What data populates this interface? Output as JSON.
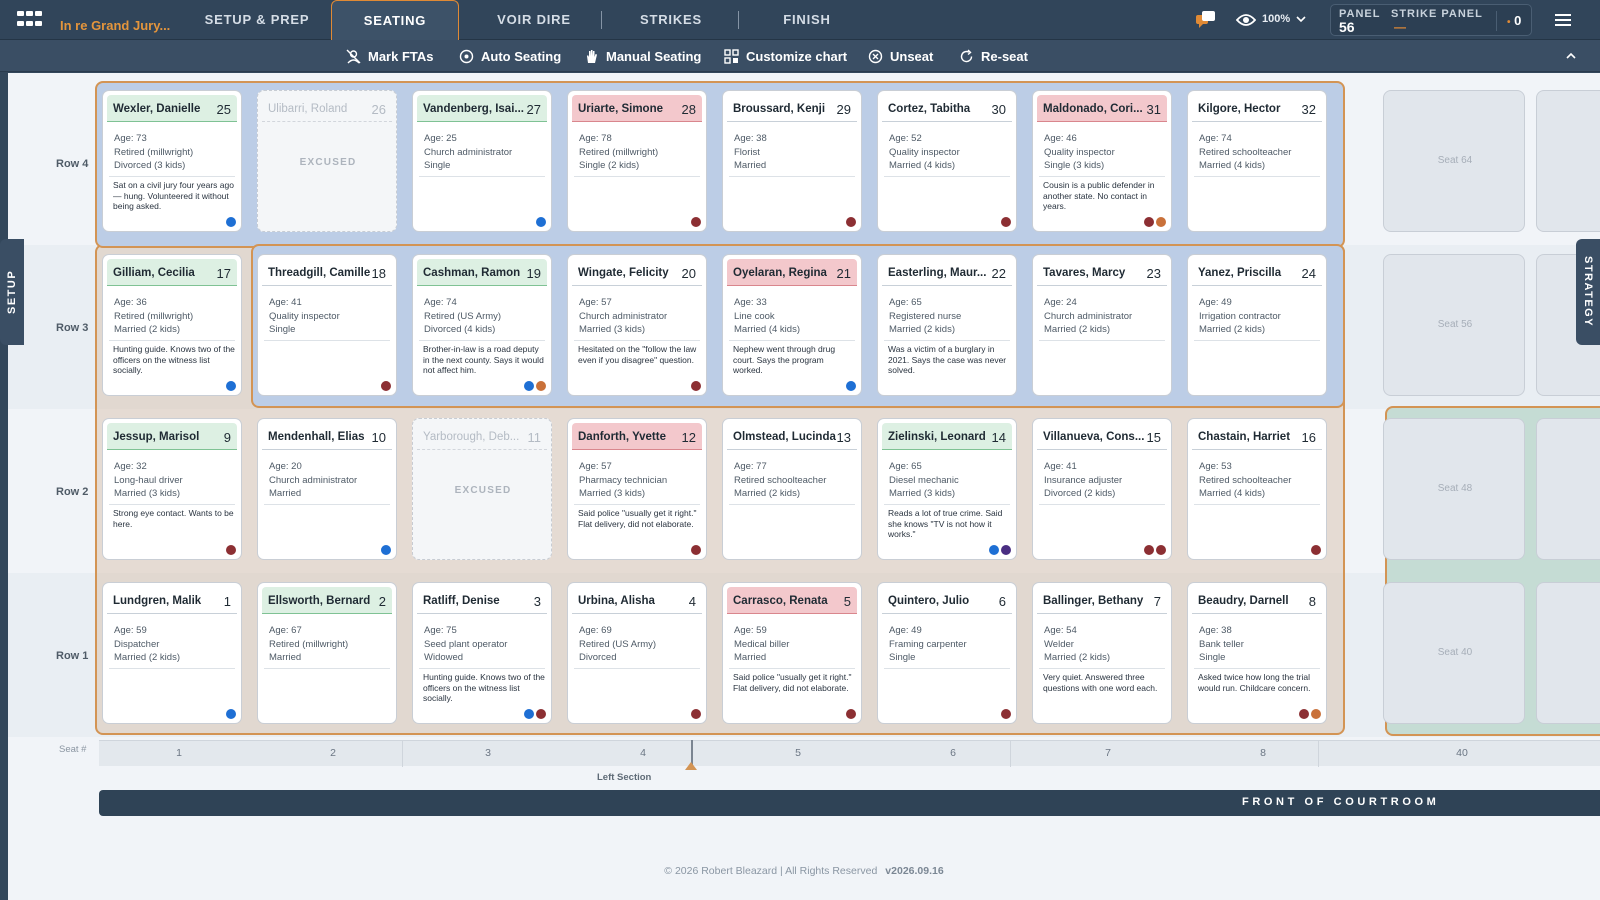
{
  "app": {
    "case_title": "In re Grand Jury...",
    "zoom": "100%"
  },
  "nav": {
    "tabs": [
      {
        "label": "SETUP & PREP"
      },
      {
        "label": "SEATING"
      },
      {
        "label": "VOIR DIRE"
      },
      {
        "label": "STRIKES"
      },
      {
        "label": "FINISH"
      }
    ]
  },
  "panel": {
    "panel_label": "PANEL",
    "panel_value": "56",
    "strike_label": "STRIKE PANEL",
    "strike_value": "—",
    "count": "0"
  },
  "toolbar": {
    "items": [
      {
        "label": "Mark FTAs"
      },
      {
        "label": "Auto Seating"
      },
      {
        "label": "Manual Seating"
      },
      {
        "label": "Customize chart"
      },
      {
        "label": "Unseat"
      },
      {
        "label": "Re-seat"
      }
    ]
  },
  "side_tabs": {
    "left": "SETUP",
    "right": "STRATEGY"
  },
  "rows": [
    "Row 4",
    "Row 3",
    "Row 2",
    "Row 1"
  ],
  "excused_label": "EXCUSED",
  "jurors": [
    {
      "name": "Wexler, Danielle",
      "num": "25",
      "hdr": "green",
      "age": "Age: 73",
      "occ": "Retired (millwright)",
      "family": "Divorced (3 kids)",
      "note": "Sat on a civil jury four years ago — hung. Volunteered it without being asked.",
      "dots": [
        "blue"
      ]
    },
    {
      "name": "Ulibarri, Roland",
      "num": "26",
      "excused": true
    },
    {
      "name": "Vandenberg, Isai...",
      "num": "27",
      "hdr": "green",
      "age": "Age: 25",
      "occ": "Church administrator",
      "family": "Single",
      "note": "",
      "dots": [
        "blue"
      ]
    },
    {
      "name": "Uriarte, Simone",
      "num": "28",
      "hdr": "red",
      "age": "Age: 78",
      "occ": "Retired (millwright)",
      "family": "Single (2 kids)",
      "note": "",
      "dots": [
        "red"
      ]
    },
    {
      "name": "Broussard, Kenji",
      "num": "29",
      "hdr": "",
      "age": "Age: 38",
      "occ": "Florist",
      "family": "Married",
      "note": "",
      "dots": [
        "red"
      ]
    },
    {
      "name": "Cortez, Tabitha",
      "num": "30",
      "hdr": "",
      "age": "Age: 52",
      "occ": "Quality inspector",
      "family": "Married (4 kids)",
      "note": "",
      "dots": [
        "red"
      ]
    },
    {
      "name": "Maldonado, Cori...",
      "num": "31",
      "hdr": "red",
      "age": "Age: 46",
      "occ": "Quality inspector",
      "family": "Single (3 kids)",
      "note": "Cousin is a public defender in another state. No contact in years.",
      "dots": [
        "red",
        "orange"
      ]
    },
    {
      "name": "Kilgore, Hector",
      "num": "32",
      "hdr": "",
      "age": "Age: 74",
      "occ": "Retired schoolteacher",
      "family": "Married (4 kids)",
      "note": "",
      "dots": []
    },
    {
      "name": "Gilliam, Cecilia",
      "num": "17",
      "hdr": "green",
      "age": "Age: 36",
      "occ": "Retired (millwright)",
      "family": "Married (2 kids)",
      "note": "Hunting guide. Knows two of the officers on the witness list socially.",
      "dots": [
        "blue"
      ]
    },
    {
      "name": "Threadgill, Camille",
      "num": "18",
      "hdr": "",
      "age": "Age: 41",
      "occ": "Quality inspector",
      "family": "Single",
      "note": "",
      "dots": [
        "red"
      ]
    },
    {
      "name": "Cashman, Ramon",
      "num": "19",
      "hdr": "green",
      "age": "Age: 74",
      "occ": "Retired (US Army)",
      "family": "Divorced (4 kids)",
      "note": "Brother-in-law is a road deputy in the next county. Says it would not affect him.",
      "dots": [
        "blue",
        "orange"
      ]
    },
    {
      "name": "Wingate, Felicity",
      "num": "20",
      "hdr": "",
      "age": "Age: 57",
      "occ": "Church administrator",
      "family": "Married (3 kids)",
      "note": "Hesitated on the \"follow the law even if you disagree\" question.",
      "dots": [
        "red"
      ]
    },
    {
      "name": "Oyelaran, Regina",
      "num": "21",
      "hdr": "red",
      "age": "Age: 33",
      "occ": "Line cook",
      "family": "Married (4 kids)",
      "note": "Nephew went through drug court. Says the program worked.",
      "dots": [
        "blue"
      ]
    },
    {
      "name": "Easterling, Maur...",
      "num": "22",
      "hdr": "",
      "age": "Age: 65",
      "occ": "Registered nurse",
      "family": "Married (2 kids)",
      "note": "Was a victim of a burglary in 2021. Says the case was never solved.",
      "dots": []
    },
    {
      "name": "Tavares, Marcy",
      "num": "23",
      "hdr": "",
      "age": "Age: 24",
      "occ": "Church administrator",
      "family": "Married (2 kids)",
      "note": "",
      "dots": []
    },
    {
      "name": "Yanez, Priscilla",
      "num": "24",
      "hdr": "",
      "age": "Age: 49",
      "occ": "Irrigation contractor",
      "family": "Married (2 kids)",
      "note": "",
      "dots": []
    },
    {
      "name": "Jessup, Marisol",
      "num": "9",
      "hdr": "green",
      "age": "Age: 32",
      "occ": "Long-haul driver",
      "family": "Married (3 kids)",
      "note": "Strong eye contact. Wants to be here.",
      "dots": [
        "red"
      ]
    },
    {
      "name": "Mendenhall, Elias",
      "num": "10",
      "hdr": "",
      "age": "Age: 20",
      "occ": "Church administrator",
      "family": "Married",
      "note": "",
      "dots": [
        "blue"
      ]
    },
    {
      "name": "Yarborough, Deb...",
      "num": "11",
      "excused": true
    },
    {
      "name": "Danforth, Yvette",
      "num": "12",
      "hdr": "red",
      "age": "Age: 57",
      "occ": "Pharmacy technician",
      "family": "Married (3 kids)",
      "note": "Said police \"usually get it right.\" Flat delivery, did not elaborate.",
      "dots": [
        "red"
      ]
    },
    {
      "name": "Olmstead, Lucinda",
      "num": "13",
      "hdr": "",
      "age": "Age: 77",
      "occ": "Retired schoolteacher",
      "family": "Married (2 kids)",
      "note": "",
      "dots": []
    },
    {
      "name": "Zielinski, Leonard",
      "num": "14",
      "hdr": "green",
      "age": "Age: 65",
      "occ": "Diesel mechanic",
      "family": "Married (3 kids)",
      "note": "Reads a lot of true crime. Said she knows \"TV is not how it works.\"",
      "dots": [
        "blue",
        "purple"
      ]
    },
    {
      "name": "Villanueva, Cons...",
      "num": "15",
      "hdr": "",
      "age": "Age: 41",
      "occ": "Insurance adjuster",
      "family": "Divorced (2 kids)",
      "note": "",
      "dots": [
        "red",
        "red"
      ]
    },
    {
      "name": "Chastain, Harriet",
      "num": "16",
      "hdr": "",
      "age": "Age: 53",
      "occ": "Retired schoolteacher",
      "family": "Married (4 kids)",
      "note": "",
      "dots": [
        "red"
      ]
    },
    {
      "name": "Lundgren, Malik",
      "num": "1",
      "hdr": "",
      "age": "Age: 59",
      "occ": "Dispatcher",
      "family": "Married (2 kids)",
      "note": "",
      "dots": [
        "blue"
      ]
    },
    {
      "name": "Ellsworth, Bernard",
      "num": "2",
      "hdr": "green",
      "age": "Age: 67",
      "occ": "Retired (millwright)",
      "family": "Married",
      "note": "",
      "dots": []
    },
    {
      "name": "Ratliff, Denise",
      "num": "3",
      "hdr": "",
      "age": "Age: 75",
      "occ": "Seed plant operator",
      "family": "Widowed",
      "note": "Hunting guide. Knows two of the officers on the witness list socially.",
      "dots": [
        "blue",
        "red"
      ]
    },
    {
      "name": "Urbina, Alisha",
      "num": "4",
      "hdr": "",
      "age": "Age: 69",
      "occ": "Retired (US Army)",
      "family": "Divorced",
      "note": "",
      "dots": [
        "red"
      ]
    },
    {
      "name": "Carrasco, Renata",
      "num": "5",
      "hdr": "red",
      "age": "Age: 59",
      "occ": "Medical biller",
      "family": "Married",
      "note": "Said police \"usually get it right.\" Flat delivery, did not elaborate.",
      "dots": [
        "red"
      ]
    },
    {
      "name": "Quintero, Julio",
      "num": "6",
      "hdr": "",
      "age": "Age: 49",
      "occ": "Framing carpenter",
      "family": "Single",
      "note": "",
      "dots": [
        "red"
      ]
    },
    {
      "name": "Ballinger, Bethany",
      "num": "7",
      "hdr": "",
      "age": "Age: 54",
      "occ": "Welder",
      "family": "Married (2 kids)",
      "note": "Very quiet. Answered three questions with one word each.",
      "dots": []
    },
    {
      "name": "Beaudry, Darnell",
      "num": "8",
      "hdr": "",
      "age": "Age: 38",
      "occ": "Bank teller",
      "family": "Single",
      "note": "Asked twice how long the trial would run. Childcare concern.",
      "dots": [
        "red",
        "orange"
      ]
    }
  ],
  "empty_seats": [
    "Seat 64",
    "Seat 56",
    "Seat 48",
    "Seat 40"
  ],
  "seat_axis": {
    "label": "Seat #",
    "numbers": [
      "1",
      "2",
      "3",
      "4",
      "5",
      "6",
      "7",
      "8",
      "40"
    ],
    "section_label": "Left Section"
  },
  "front_label": "FRONT OF COURTROOM",
  "footer": {
    "copyright": "© 2026 Robert Bleazard | All Rights Reserved",
    "version": "v2026.09.16"
  }
}
